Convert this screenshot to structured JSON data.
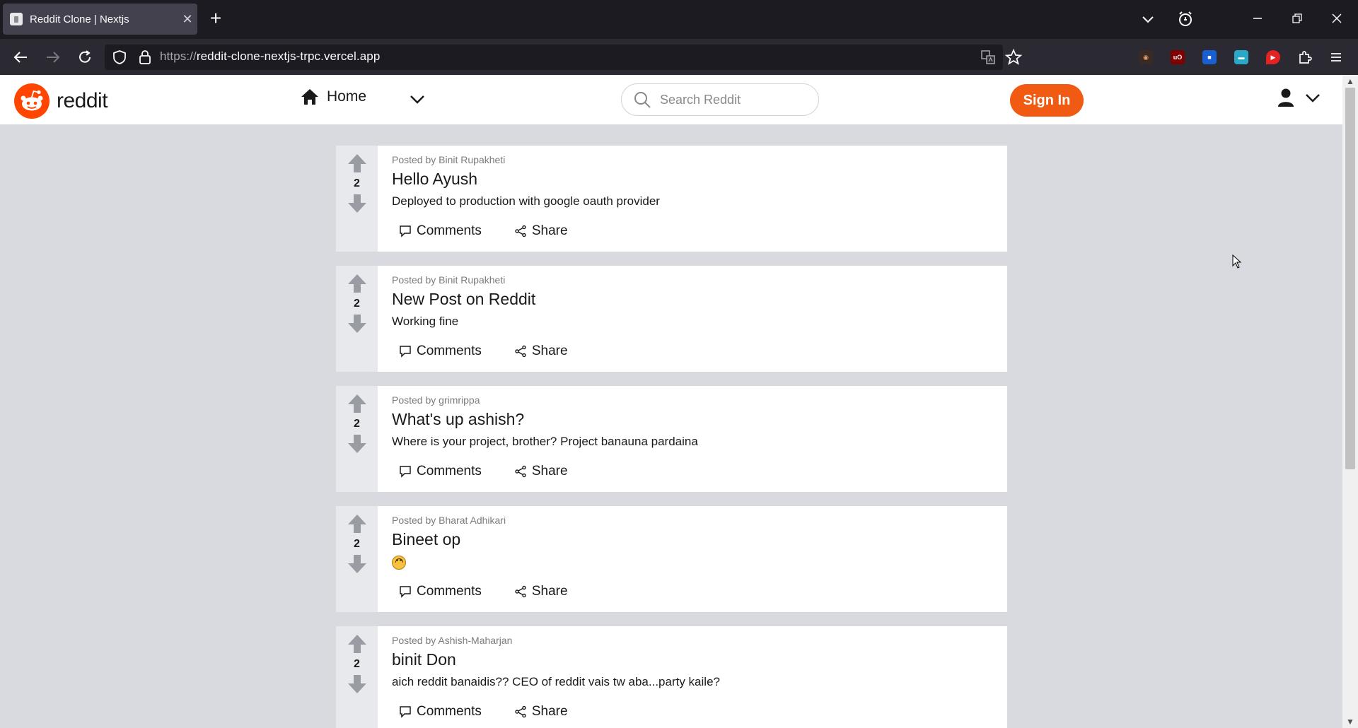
{
  "browser": {
    "tab_title": "Reddit Clone | Nextjs",
    "url_protocol": "https://",
    "url_host": "reddit-clone-nextjs-trpc.vercel.app"
  },
  "site": {
    "logo_text": "reddit",
    "nav_home": "Home",
    "search_placeholder": "Search Reddit",
    "signin_label": "Sign In",
    "accent_color": "#f05a12"
  },
  "posts": [
    {
      "meta": "Posted by Binit Rupakheti",
      "title": "Hello Ayush",
      "body": "Deployed to production with google oauth provider",
      "votes": "2",
      "comments_label": "Comments",
      "share_label": "Share"
    },
    {
      "meta": "Posted by Binit Rupakheti",
      "title": "New Post on Reddit",
      "body": "Working fine",
      "votes": "2",
      "comments_label": "Comments",
      "share_label": "Share"
    },
    {
      "meta": "Posted by grimrippa",
      "title": "What's up ashish?",
      "body": "Where is your project, brother? Project banauna pardaina",
      "votes": "2",
      "comments_label": "Comments",
      "share_label": "Share"
    },
    {
      "meta": "Posted by Bharat Adhikari",
      "title": "Bineet op",
      "body": "",
      "body_icon": "upside-down-face-emoji",
      "votes": "2",
      "comments_label": "Comments",
      "share_label": "Share"
    },
    {
      "meta": "Posted by Ashish-Maharjan",
      "title": "binit Don",
      "body": "aich reddit banaidis?? CEO of reddit vais tw aba...party kaile?",
      "votes": "2",
      "comments_label": "Comments",
      "share_label": "Share"
    }
  ]
}
